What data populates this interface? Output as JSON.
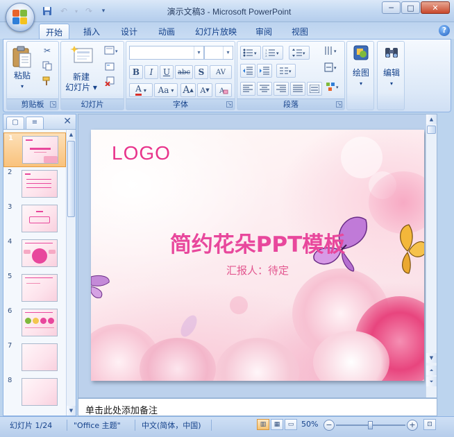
{
  "window": {
    "title": "演示文稿3 - Microsoft PowerPoint",
    "minimize": "─",
    "maximize": "□",
    "close": "✕"
  },
  "qat": {
    "save_icon": "save-icon",
    "undo_icon": "undo-icon",
    "redo_icon": "redo-icon",
    "customize_icon": "customize-icon"
  },
  "tabs": [
    {
      "label": "开始",
      "active": true
    },
    {
      "label": "插入"
    },
    {
      "label": "设计"
    },
    {
      "label": "动画"
    },
    {
      "label": "幻灯片放映"
    },
    {
      "label": "审阅"
    },
    {
      "label": "视图"
    }
  ],
  "help": "?",
  "ribbon": {
    "clipboard": {
      "label": "剪贴板",
      "paste": "粘贴",
      "paste_arrow": "▾"
    },
    "slides": {
      "label": "幻灯片",
      "new_slide_line1": "新建",
      "new_slide_line2": "幻灯片 ▾"
    },
    "font": {
      "label": "字体",
      "bold": "B",
      "italic": "I",
      "underline": "U",
      "strike": "abc",
      "shadow": "S",
      "spacing": "AV",
      "font_color": "A",
      "change_case": "Aa",
      "grow": "A",
      "shrink": "A"
    },
    "paragraph": {
      "label": "段落"
    },
    "drawing": {
      "label": "绘图"
    },
    "editing": {
      "label": "编辑"
    }
  },
  "slides_panel": {
    "tab_slides": "▢",
    "tab_outline": "≡",
    "close": "✕",
    "thumbnails": [
      "1",
      "2",
      "3",
      "4",
      "5",
      "6",
      "7",
      "8"
    ],
    "selected": 1
  },
  "slide": {
    "logo": "LOGO",
    "title": "简约花朵PPT模板",
    "subtitle": "汇报人：待定"
  },
  "notes": {
    "placeholder": "单击此处添加备注"
  },
  "status": {
    "slide_indicator": "幻灯片 1/24",
    "theme": "\"Office 主题\"",
    "language": "中文(简体，中国)",
    "zoom": "50%",
    "zoom_out": "−",
    "zoom_in": "+"
  },
  "colors": {
    "accent_pink": "#e8479c",
    "ribbon_blue": "#15428b"
  }
}
